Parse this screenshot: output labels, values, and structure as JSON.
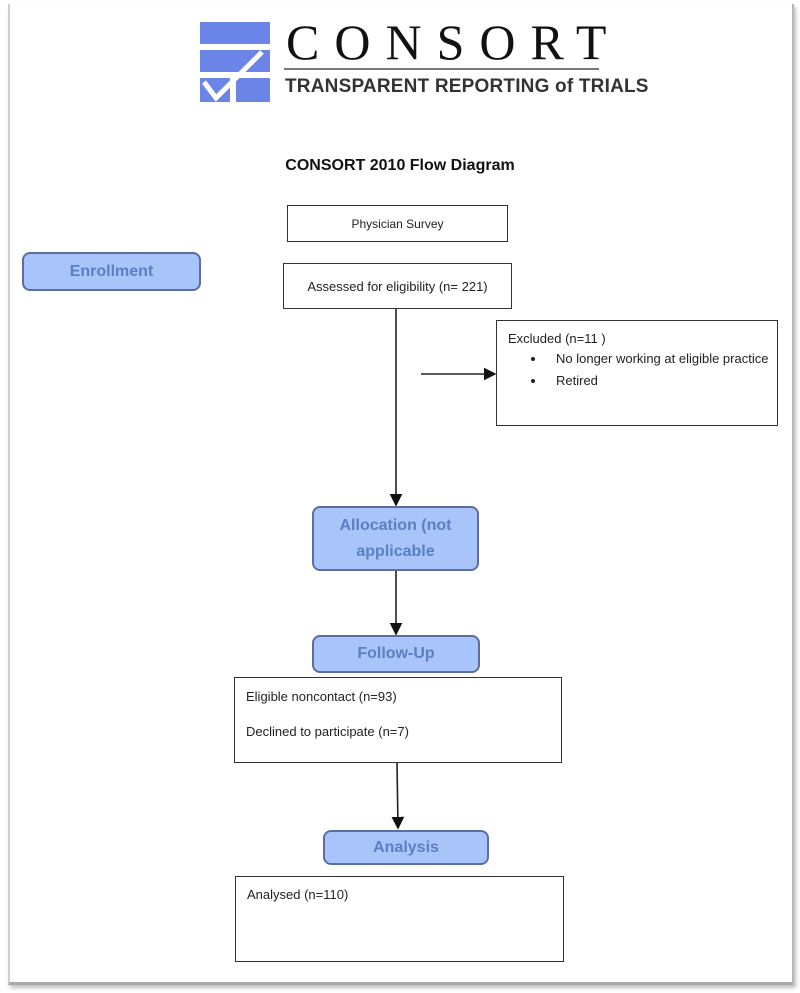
{
  "logo": {
    "wordmark": "CONSORT",
    "tagline": "TRANSPARENT REPORTING of TRIALS",
    "mark_color": "#6b84e8"
  },
  "title": "CONSORT 2010 Flow Diagram",
  "phases": {
    "enrollment": "Enrollment",
    "allocation": "Allocation (not applicable",
    "follow_up": "Follow-Up",
    "analysis": "Analysis"
  },
  "boxes": {
    "source": "Physician Survey",
    "assessed": "Assessed for eligibility (n= 221)",
    "excluded": {
      "heading": "Excluded  (n=11 )",
      "reasons": [
        "No longer working at eligible practice",
        "Retired"
      ]
    },
    "follow_up": {
      "lines": [
        "Eligible noncontact (n=93)",
        "Declined to participate (n=7)"
      ]
    },
    "analysed": "Analysed  (n=110)"
  },
  "colors": {
    "phase_fill": "#a9c4fb",
    "phase_text": "#5b7fc0",
    "phase_border": "#5b6e9e"
  }
}
